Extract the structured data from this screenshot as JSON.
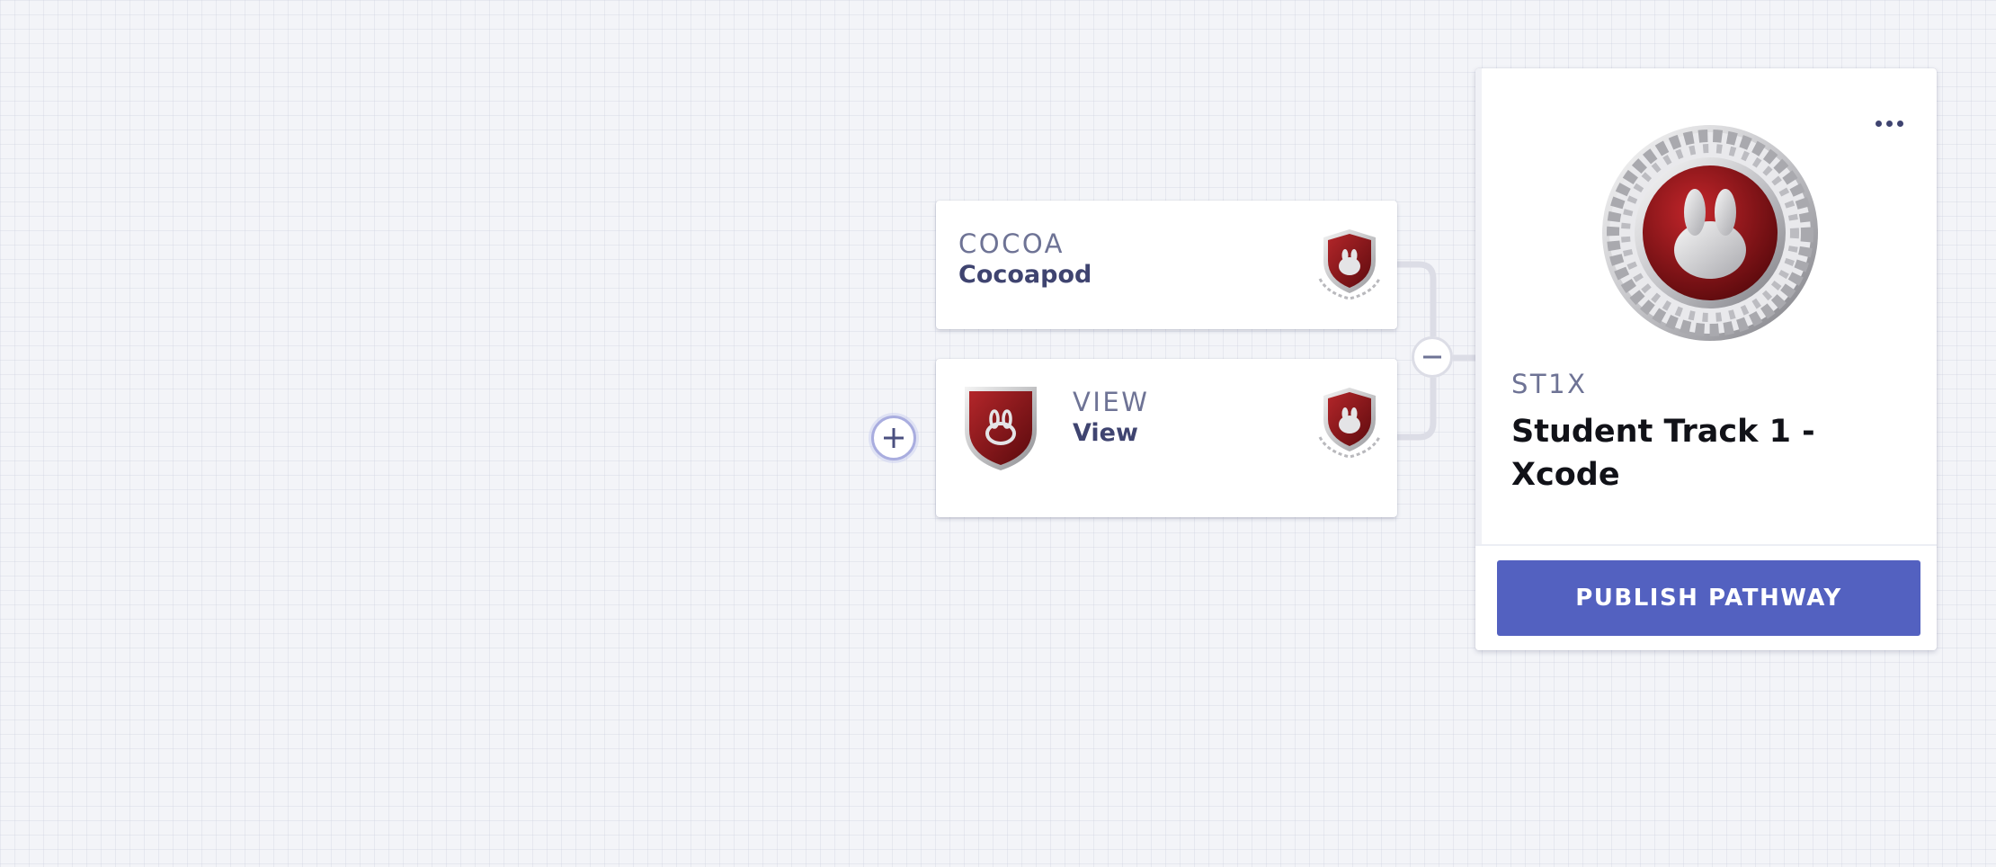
{
  "colors": {
    "canvas_background": "#f3f4f8",
    "primary": "#5361c0",
    "node_code_text": "#6e7395",
    "node_name_text": "#3f4470",
    "pathway_title_text": "#111218",
    "badge_red": "#8e1518",
    "badge_silver": "#c9c9cc"
  },
  "nodes": [
    {
      "code": "COCOA",
      "name": "Cocoapod",
      "status_icon": "shield-badge-bunny-icon"
    },
    {
      "code": "VIEW",
      "name": "View",
      "badge_icon": "shield-badge-bunny-icon",
      "status_icon": "shield-badge-bunny-icon"
    }
  ],
  "controls": {
    "add_icon": "plus-icon",
    "collapse_icon": "minus-icon"
  },
  "pathway": {
    "code": "ST1X",
    "title": "Student Track 1 - Xcode",
    "badge_icon": "medal-laurel-bunny-icon",
    "menu_icon": "more-horizontal-icon",
    "publish_label": "PUBLISH PATHWAY"
  }
}
